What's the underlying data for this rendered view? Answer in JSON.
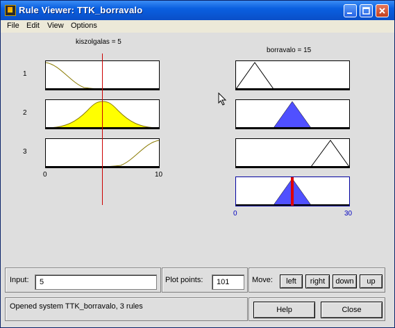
{
  "window": {
    "title": "Rule Viewer: TTK_borravalo"
  },
  "menu": [
    "File",
    "Edit",
    "View",
    "Options"
  ],
  "plots": {
    "input_title": "kiszolgalas = 5",
    "output_title": "borravalo = 15",
    "rule_numbers": [
      "1",
      "2",
      "3"
    ],
    "input_axis": {
      "min": "0",
      "max": "10"
    },
    "output_axis": {
      "min": "0",
      "max": "30"
    }
  },
  "chart_data": {
    "type": "fuzzy-rule-viewer",
    "input": {
      "name": "kiszolgalas",
      "value": 5,
      "range": [
        0,
        10
      ]
    },
    "output": {
      "name": "borravalo",
      "value": 15,
      "range": [
        0,
        30
      ]
    },
    "rules": [
      {
        "rule": 1,
        "input_mf": "gaussian",
        "input_center": 0,
        "input_fire": 0.0,
        "output_mf": "triangle",
        "output_params": [
          0,
          5,
          10
        ]
      },
      {
        "rule": 2,
        "input_mf": "gaussian",
        "input_center": 5,
        "input_fire": 1.0,
        "output_mf": "triangle",
        "output_params": [
          10,
          15,
          20
        ]
      },
      {
        "rule": 3,
        "input_mf": "gaussian",
        "input_center": 10,
        "input_fire": 0.0,
        "output_mf": "triangle",
        "output_params": [
          20,
          25,
          30
        ]
      }
    ],
    "aggregated_output": {
      "shape": "triangle",
      "params": [
        10,
        15,
        20
      ],
      "defuzzified": 15
    }
  },
  "controls": {
    "input_label": "Input:",
    "input_value": "5",
    "plot_points_label": "Plot points:",
    "plot_points_value": "101",
    "move_label": "Move:",
    "move_buttons": [
      "left",
      "right",
      "down",
      "up"
    ],
    "status": "Opened system TTK_borravalo, 3 rules",
    "help": "Help",
    "close": "Close"
  },
  "colors": {
    "fill_input": "#ffff00",
    "fill_output": "#5050ff",
    "index_line": "#cc0000",
    "axis_text_output": "#0000c0"
  }
}
